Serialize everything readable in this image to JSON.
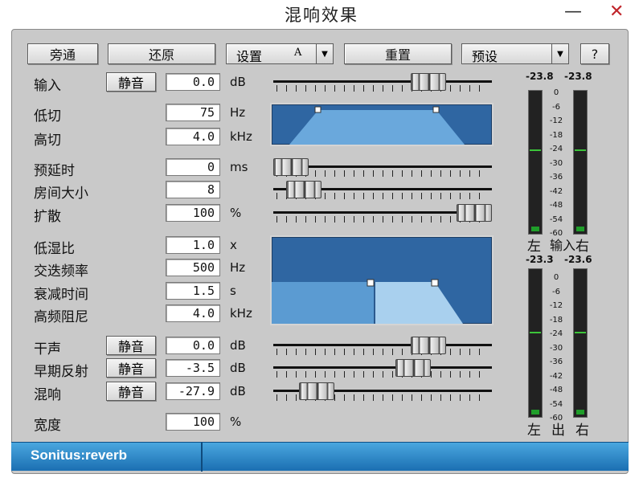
{
  "window": {
    "title": "混响效果",
    "minimize": "—",
    "close": "✕"
  },
  "toolbar": {
    "bypass": "旁通",
    "restore": "还原",
    "setup_label": "设置",
    "setup_value": "A",
    "reset": "重置",
    "preset": "预设",
    "help": "?"
  },
  "input": {
    "label": "输入",
    "mute": "静音",
    "value": "0.0",
    "unit": "dB",
    "level": 0.71
  },
  "filters": {
    "lowcut": {
      "label": "低切",
      "value": "75",
      "unit": "Hz"
    },
    "highcut": {
      "label": "高切",
      "value": "4.0",
      "unit": "kHz"
    }
  },
  "predelay": {
    "label": "预延时",
    "value": "0",
    "unit": "ms",
    "level": 0.03
  },
  "roomsize": {
    "label": "房间大小",
    "value": "8",
    "unit": "",
    "level": 0.14
  },
  "diffusion": {
    "label": "扩散",
    "value": "100",
    "unit": "%",
    "level": 0.97
  },
  "reverb_params": {
    "lowdamp": {
      "label": "低湿比",
      "value": "1.0",
      "unit": "x"
    },
    "crossover": {
      "label": "交迭频率",
      "value": "500",
      "unit": "Hz"
    },
    "decay": {
      "label": "衰减时间",
      "value": "1.5",
      "unit": "s"
    },
    "hfdamp": {
      "label": "高频阻尼",
      "value": "4.0",
      "unit": "kHz"
    }
  },
  "dry": {
    "label": "干声",
    "mute": "静音",
    "value": "0.0",
    "unit": "dB",
    "level": 0.71
  },
  "early": {
    "label": "早期反射",
    "mute": "静音",
    "value": "-3.5",
    "unit": "dB",
    "level": 0.64
  },
  "reverb": {
    "label": "混响",
    "mute": "静音",
    "value": "-27.9",
    "unit": "dB",
    "level": 0.2
  },
  "width": {
    "label": "宽度",
    "value": "100",
    "unit": "%"
  },
  "meters": {
    "input": {
      "left_peak": "-23.8",
      "right_peak": "-23.8",
      "left": "左",
      "mid": "输入",
      "right": "右"
    },
    "output": {
      "left_peak": "-23.3",
      "right_peak": "-23.6",
      "left": "左",
      "mid": "出",
      "right": "右"
    },
    "scale": [
      "0",
      "-6",
      "-12",
      "-18",
      "-24",
      "-30",
      "-36",
      "-42",
      "-48",
      "-54",
      "-60"
    ]
  },
  "status": {
    "name": "Sonitus:reverb"
  },
  "colors": {
    "accent": "#2f66a2",
    "status_bar": "#2b8ad0",
    "meter_green": "#1f9e2a"
  }
}
